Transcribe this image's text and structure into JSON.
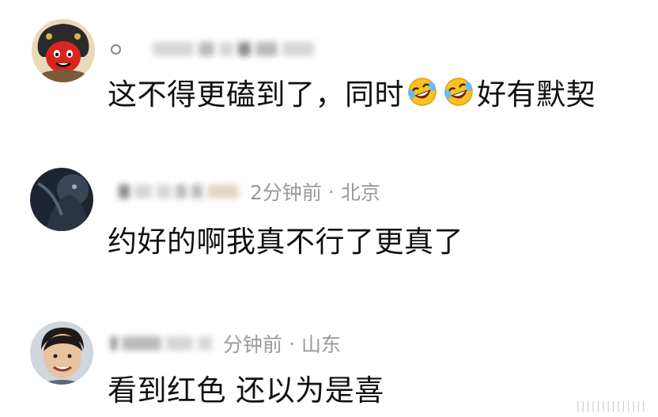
{
  "comments": [
    {
      "marker": "。",
      "username": "",
      "time": "",
      "location": "",
      "text_before": "这不得更磕到了，同时",
      "emoji": [
        "rolling-on-floor-laughing-emoji",
        "rolling-on-floor-laughing-emoji"
      ],
      "text_after": "好有默契"
    },
    {
      "username": "",
      "time": "2分钟前",
      "separator": "·",
      "location": "北京",
      "text": "约好的啊我真不行了更真了"
    },
    {
      "username": "",
      "time": "分钟前",
      "separator": "·",
      "location": "山东",
      "text": "看到红色 还以为是喜"
    }
  ],
  "watermark": "||||||||||||||",
  "colors": {
    "text": "#111111",
    "meta": "#9a9a9a",
    "background": "#ffffff"
  }
}
